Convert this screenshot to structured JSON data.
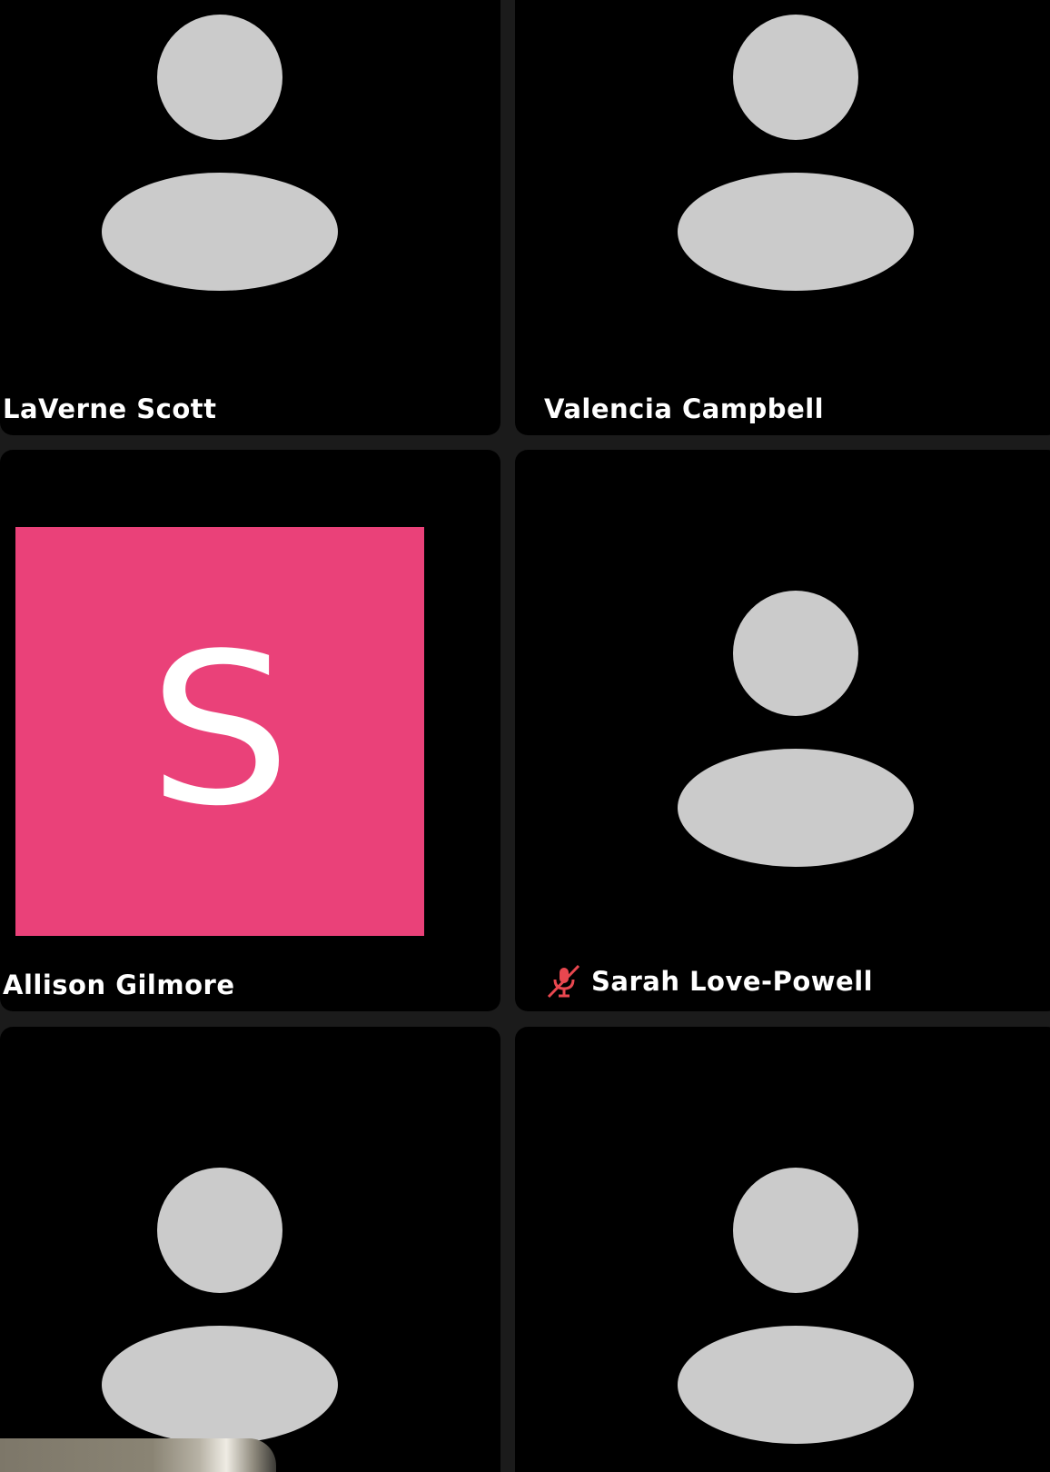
{
  "participants": [
    {
      "name": "LaVerne Scott",
      "avatar": "person-placeholder-icon",
      "muted": false
    },
    {
      "name": "Valencia Campbell",
      "avatar": "person-placeholder-icon",
      "muted": false
    },
    {
      "name": "Allison Gilmore",
      "avatar": "profile-image",
      "avatar_letter": "S",
      "avatar_color": "#ea4179",
      "muted": false
    },
    {
      "name": "Sarah Love-Powell",
      "avatar": "person-placeholder-icon",
      "muted": true
    },
    {
      "name": "",
      "avatar": "person-placeholder-icon",
      "muted": false
    },
    {
      "name": "",
      "avatar": "person-placeholder-icon",
      "muted": false
    }
  ],
  "colors": {
    "background": "#1b1b1b",
    "tile": "#000000",
    "placeholder": "#cbcbcb",
    "mute": "#e8474f"
  }
}
